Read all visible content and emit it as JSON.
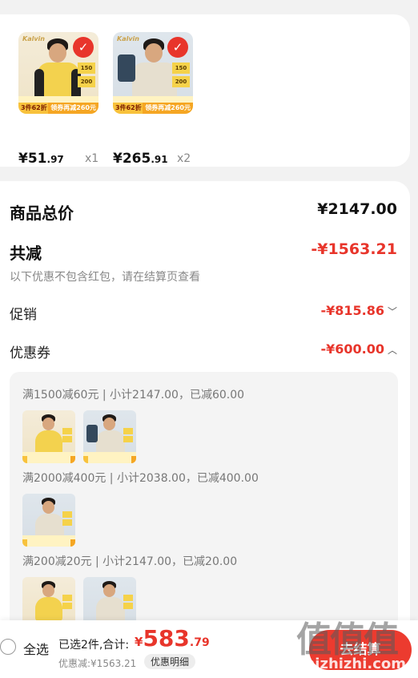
{
  "products": [
    {
      "price_yen": "¥",
      "price_int": "51",
      "price_dec": ".97",
      "qty": "x1",
      "brand": "Kalvin",
      "promo_left": "3件62折",
      "promo_right": "领券再减260元",
      "tags": [
        "150",
        "200"
      ],
      "colors": {
        "bg": "#f4ecd9",
        "shirt": "#f3d24e"
      }
    },
    {
      "price_yen": "¥",
      "price_int": "265",
      "price_dec": ".91",
      "qty": "x2",
      "brand": "Kalvin",
      "promo_left": "3件62折",
      "promo_right": "领券再减260元",
      "tags": [
        "150",
        "200"
      ],
      "colors": {
        "bg": "#dfe6ec",
        "shirt": "#e6dfcf"
      }
    }
  ],
  "summary": {
    "total_label": "商品总价",
    "total_value": "¥2147.00",
    "discount_label": "共减",
    "discount_value": "-¥1563.21",
    "note": "以下优惠不包含红包，请在结算页查看",
    "promo_label": "促销",
    "promo_value": "-¥815.86",
    "coupon_label": "优惠券",
    "coupon_value": "-¥600.00"
  },
  "coupons": [
    {
      "text": "满1500减60元 | 小计2147.00，已减60.00"
    },
    {
      "text": "满2000减400元 | 小计2038.00，已减400.00"
    },
    {
      "text": "满200减20元 | 小计2147.00，已减20.00"
    }
  ],
  "bottom_bar": {
    "select_all": "全选",
    "selected_text": "已选2件,合计:",
    "total_yen": "¥",
    "total_int": "583",
    "total_dec": ".79",
    "saved": "优惠减:¥1563.21",
    "detail_btn": "优惠明细",
    "checkout_btn": "去结算"
  },
  "watermark": {
    "glyphs": "值值值",
    "url": "zhizhizhi.com"
  },
  "colors": {
    "accent_red": "#e8352b",
    "background": "#f2f2f2"
  }
}
